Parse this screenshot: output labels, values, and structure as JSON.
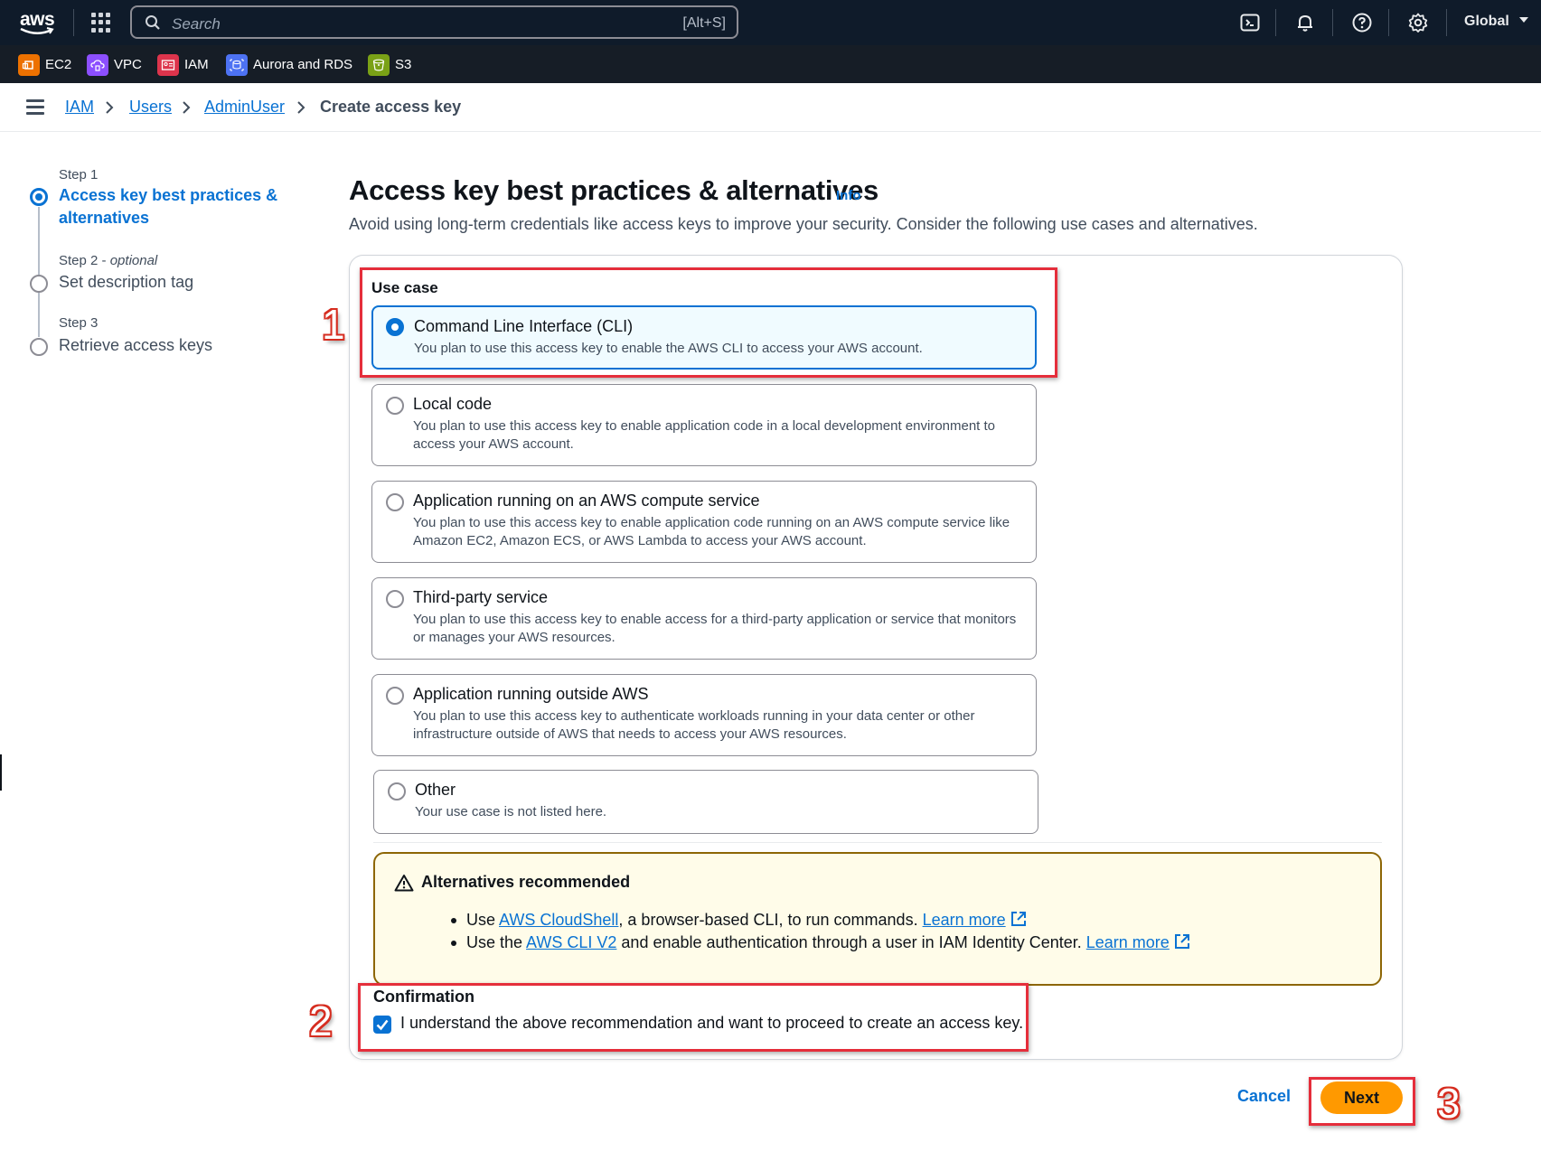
{
  "topnav": {
    "logo_text": "aws",
    "search_placeholder": "Search",
    "search_shortcut": "[Alt+S]",
    "region": "Global",
    "icons": [
      "grid-icon",
      "search-icon",
      "cloudshell-icon",
      "bell-icon",
      "help-icon",
      "gear-icon",
      "caret-down-icon"
    ]
  },
  "favorites": [
    {
      "label": "EC2",
      "color": "#ed7100"
    },
    {
      "label": "VPC",
      "color": "#8c4fff"
    },
    {
      "label": "IAM",
      "color": "#dd344c"
    },
    {
      "label": "Aurora and RDS",
      "color": "#4d72f3"
    },
    {
      "label": "S3",
      "color": "#7aa116"
    }
  ],
  "breadcrumb": {
    "items": [
      "IAM",
      "Users",
      "AdminUser"
    ],
    "current": "Create access key"
  },
  "steps": [
    {
      "label": "Step 1",
      "title": "Access key best practices & alternatives",
      "state": "active"
    },
    {
      "label": "Step 2",
      "optional": "optional",
      "title": "Set description tag",
      "state": "pending"
    },
    {
      "label": "Step 3",
      "title": "Retrieve access keys",
      "state": "pending"
    }
  ],
  "step2_label_sep": " - ",
  "main": {
    "title": "Access key best practices & alternatives",
    "info": "Info",
    "description": "Avoid using long-term credentials like access keys to improve your security. Consider the following use cases and alternatives.",
    "usecase_label": "Use case",
    "options": [
      {
        "title": "Command Line Interface (CLI)",
        "desc": "You plan to use this access key to enable the AWS CLI to access your AWS account.",
        "selected": true
      },
      {
        "title": "Local code",
        "desc": "You plan to use this access key to enable application code in a local development environment to access your AWS account.",
        "selected": false
      },
      {
        "title": "Application running on an AWS compute service",
        "desc": "You plan to use this access key to enable application code running on an AWS compute service like Amazon EC2, Amazon ECS, or AWS Lambda to access your AWS account.",
        "selected": false
      },
      {
        "title": "Third-party service",
        "desc": "You plan to use this access key to enable access for a third-party application or service that monitors or manages your AWS resources.",
        "selected": false
      },
      {
        "title": "Application running outside AWS",
        "desc": "You plan to use this access key to authenticate workloads running in your data center or other infrastructure outside of AWS that needs to access your AWS resources.",
        "selected": false
      },
      {
        "title": "Other",
        "desc": "Your use case is not listed here.",
        "selected": false
      }
    ],
    "alert": {
      "header": "Alternatives recommended",
      "item1_pre": "Use ",
      "item1_link": "AWS CloudShell",
      "item1_post": ", a browser-based CLI, to run commands. ",
      "item2_pre": "Use the ",
      "item2_link": "AWS CLI V2",
      "item2_post": " and enable authentication through a user in IAM Identity Center. ",
      "learn_more": "Learn more"
    },
    "confirmation_label": "Confirmation",
    "confirmation_text": "I understand the above recommendation and want to proceed to create an access key.",
    "confirmation_checked": true
  },
  "footer": {
    "cancel": "Cancel",
    "next": "Next"
  },
  "annotations": {
    "callouts": [
      "1",
      "2",
      "3"
    ],
    "color": "#e52e3b"
  },
  "colors": {
    "nav_bg": "#0f1b2a",
    "link": "#0972d3",
    "primary_button": "#ff9900",
    "alert_border": "#8d6605",
    "alert_bg": "#fffce9"
  }
}
